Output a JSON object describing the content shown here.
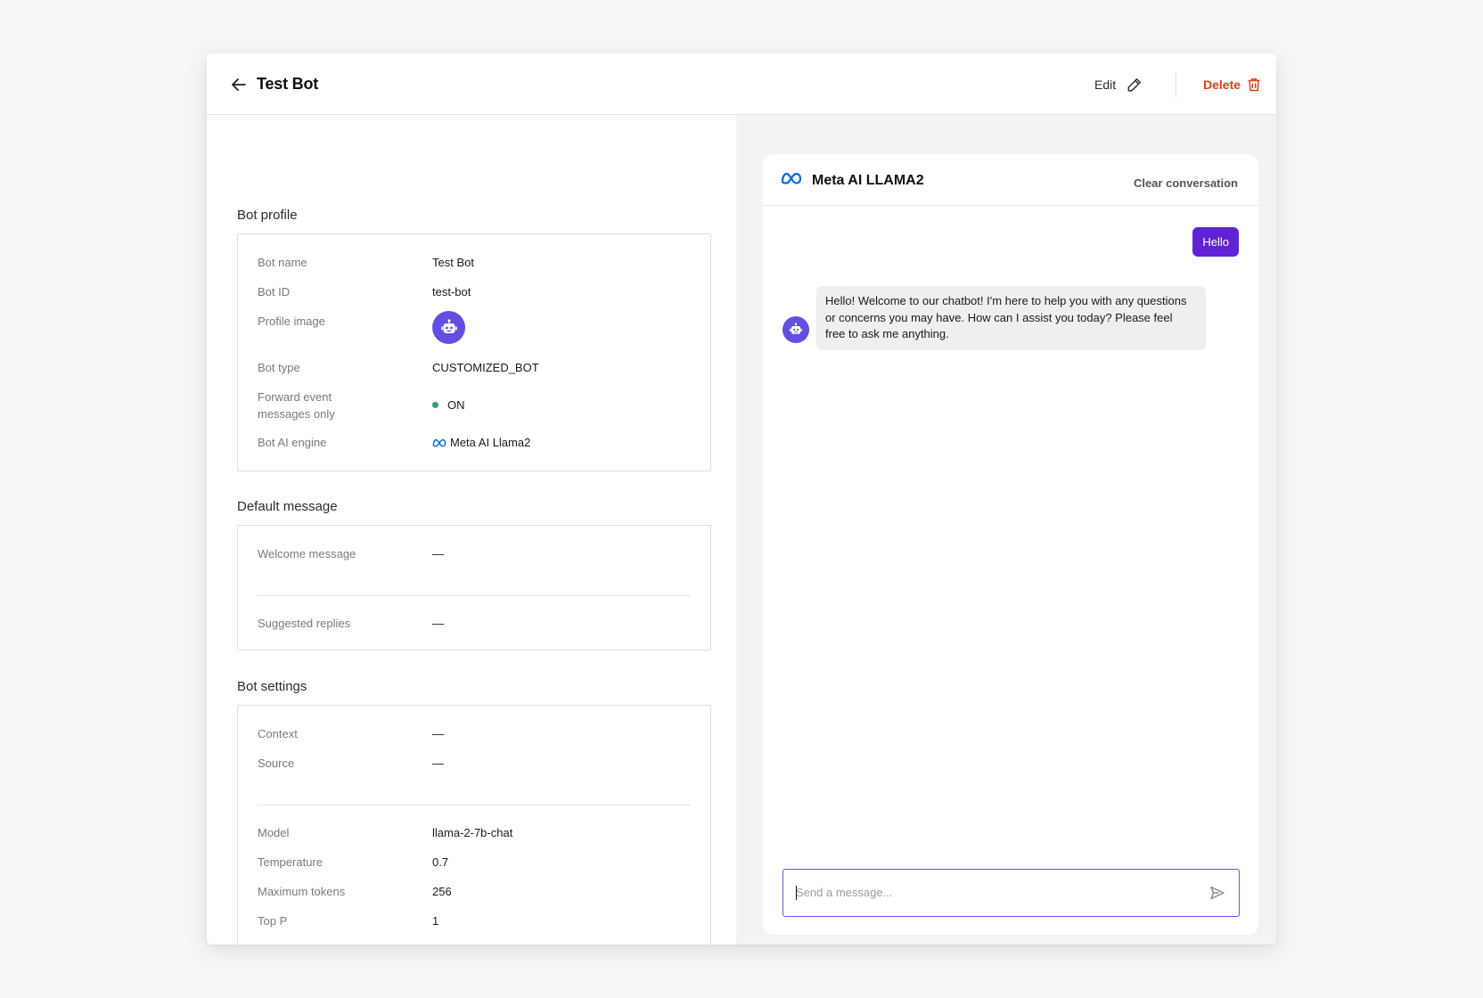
{
  "header": {
    "title": "Test Bot",
    "edit_label": "Edit",
    "delete_label": "Delete"
  },
  "bot_profile": {
    "title": "Bot profile",
    "rows": [
      {
        "label": "Bot name",
        "value": "Test Bot"
      },
      {
        "label": "Bot ID",
        "value": "test-bot"
      },
      {
        "label": "Profile image",
        "value": ""
      },
      {
        "label": "Bot type",
        "value": "CUSTOMIZED_BOT"
      },
      {
        "label": "Forward event\nmessages only",
        "value": "ON"
      },
      {
        "label": "Bot AI engine",
        "value": "Meta AI Llama2"
      }
    ]
  },
  "default_message": {
    "title": "Default message",
    "welcome_label": "Welcome message",
    "welcome_value": "—",
    "suggested_label": "Suggested replies",
    "suggested_value": "—"
  },
  "bot_settings": {
    "title": "Bot settings",
    "context_label": "Context",
    "context_value": "—",
    "source_label": "Source",
    "source_value": "—",
    "model_label": "Model",
    "model_value": "llama-2-7b-chat",
    "temperature_label": "Temperature",
    "temperature_value": "0.7",
    "max_tokens_label": "Maximum tokens",
    "max_tokens_value": "256",
    "top_p_label": "Top P",
    "top_p_value": "1"
  },
  "chat": {
    "title": "Meta AI LLAMA2",
    "clear_label": "Clear conversation",
    "user_message": "Hello",
    "bot_message": "Hello! Welcome to our chatbot! I'm here to help you with any questions or concerns you may have. How can I assist you today? Please feel free to ask me anything.",
    "input_placeholder": "Send a message..."
  },
  "colors": {
    "accent": "#6122d6",
    "avatar": "#6150e0",
    "danger": "#e0411b",
    "status_on": "#2fa36b",
    "meta_blue": "#0a66e4"
  }
}
